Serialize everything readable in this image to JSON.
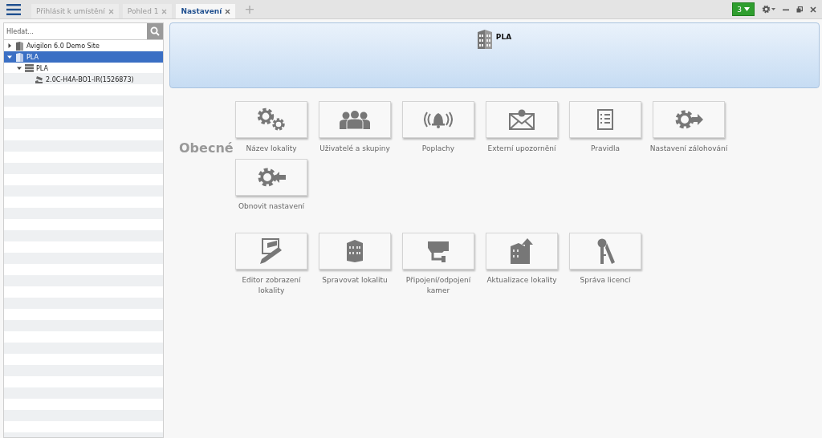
{
  "tabs": [
    {
      "label": "Přihlásit k umístění",
      "selected": false
    },
    {
      "label": "Pohled 1",
      "selected": false
    },
    {
      "label": "Nastavení",
      "selected": true
    }
  ],
  "new_tab": "+",
  "notifications": {
    "count": "3"
  },
  "tree": {
    "search": {
      "placeholder": "Hledat..."
    },
    "items": [
      {
        "label": "Avigilon 6.0 Demo Site",
        "kind": "site",
        "expanded": false,
        "selected": false
      },
      {
        "label": "PLA",
        "kind": "site",
        "expanded": true,
        "selected": true,
        "children": [
          {
            "label": "PLA",
            "kind": "server",
            "expanded": true,
            "selected": false,
            "children": [
              {
                "label": "2.0C-H4A-BO1-IR(1526873)",
                "kind": "camera",
                "selected": false
              }
            ]
          }
        ]
      }
    ]
  },
  "header": {
    "title": "PLA"
  },
  "sections": [
    {
      "title": "Obecné",
      "tiles": [
        {
          "label": "Název lokality",
          "kind": "gears"
        },
        {
          "label": "Uživatelé a skupiny",
          "kind": "people"
        },
        {
          "label": "Poplachy",
          "kind": "bell"
        },
        {
          "label": "Externí upozornění",
          "kind": "mail"
        },
        {
          "label": "Pravidla",
          "kind": "list"
        },
        {
          "label": "Nastavení zálohování",
          "kind": "export"
        },
        {
          "label": "Obnovit nastavení",
          "kind": "import"
        }
      ]
    },
    {
      "tiles": [
        {
          "label": "Editor zobrazení lokality",
          "kind": "editor"
        },
        {
          "label": "Spravovat lokalitu",
          "kind": "building"
        },
        {
          "label": "Připojení/odpojení kamer",
          "kind": "camera"
        },
        {
          "label": "Aktualizace lokality",
          "kind": "upgrade"
        },
        {
          "label": "Správa licencí",
          "kind": "keys"
        }
      ]
    }
  ]
}
